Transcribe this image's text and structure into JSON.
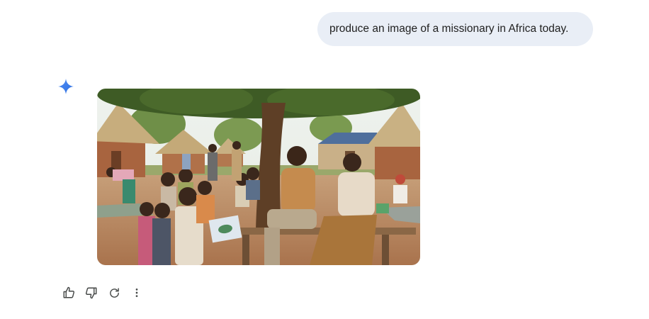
{
  "conversation": {
    "user_prompt": "produce an image of a missionary in Africa today."
  },
  "response": {
    "assistant_icon": "gemini-sparkle-icon",
    "image_alt": "A woman sitting on a bench under a tree with an elderly woman, surrounded by children in an African village with thatched huts",
    "actions": [
      {
        "name": "thumbs-up-icon"
      },
      {
        "name": "thumbs-down-icon"
      },
      {
        "name": "regenerate-icon"
      },
      {
        "name": "more-options-icon"
      }
    ]
  },
  "colors": {
    "bubble_bg": "#e9eef6",
    "text": "#1f1f1f",
    "icon": "#444746",
    "gemini_blue": "#4285f4"
  }
}
